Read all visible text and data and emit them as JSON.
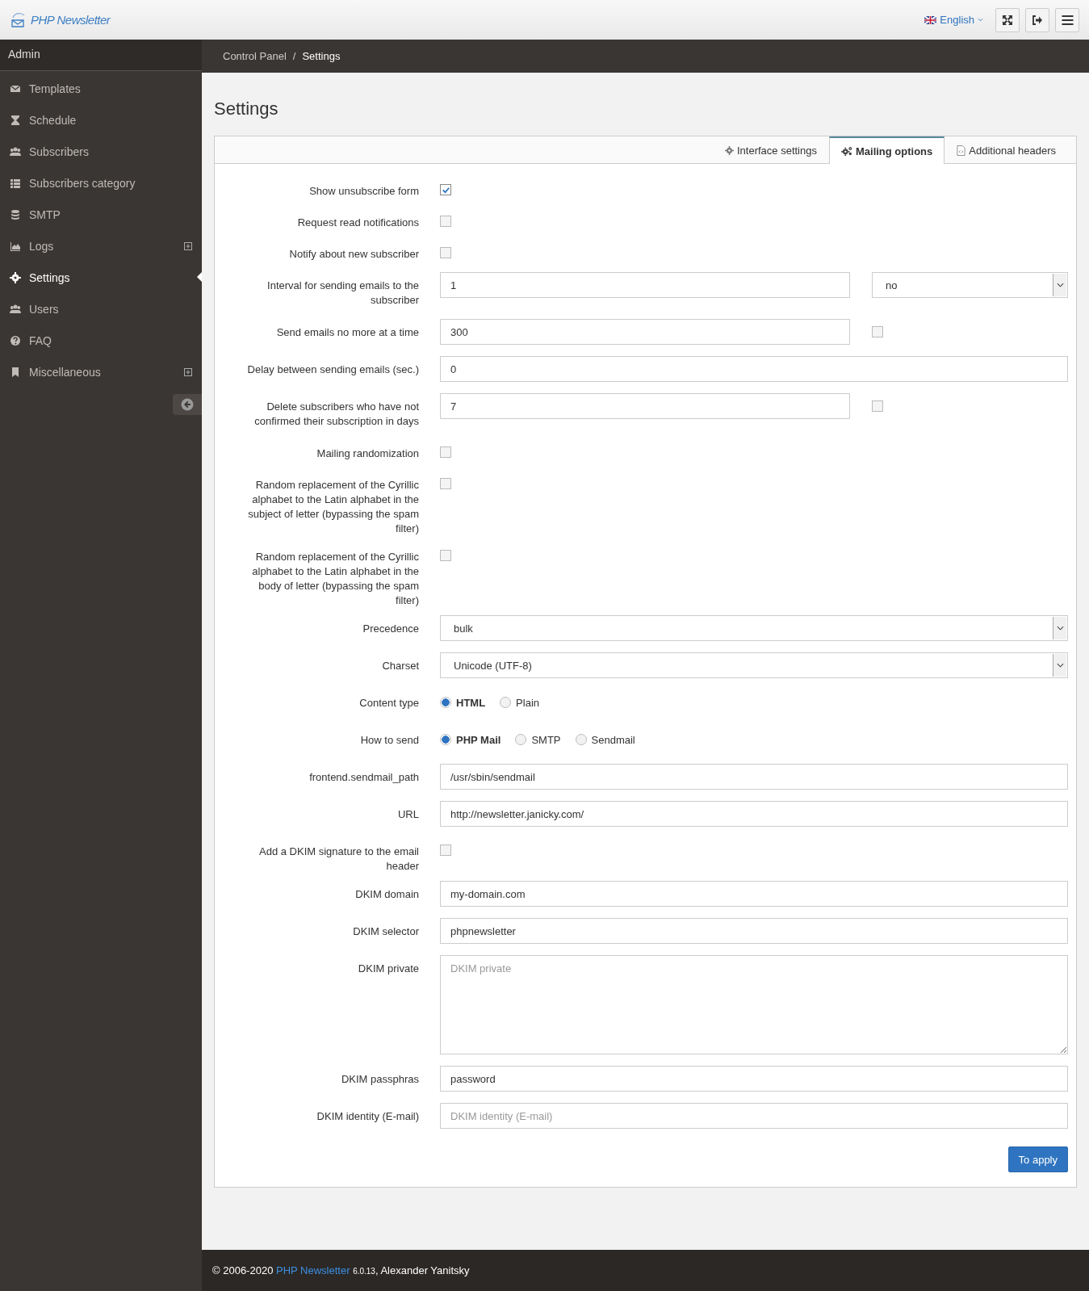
{
  "header": {
    "logo": "PHP Newsletter",
    "language": "English"
  },
  "sidebar": {
    "title": "Admin",
    "items": [
      {
        "label": "Templates",
        "selected": false,
        "expandable": false
      },
      {
        "label": "Schedule",
        "selected": false,
        "expandable": false
      },
      {
        "label": "Subscribers",
        "selected": false,
        "expandable": false
      },
      {
        "label": "Subscribers category",
        "selected": false,
        "expandable": false
      },
      {
        "label": "SMTP",
        "selected": false,
        "expandable": false
      },
      {
        "label": "Logs",
        "selected": false,
        "expandable": true
      },
      {
        "label": "Settings",
        "selected": true,
        "expandable": false
      },
      {
        "label": "Users",
        "selected": false,
        "expandable": false
      },
      {
        "label": "FAQ",
        "selected": false,
        "expandable": false
      },
      {
        "label": "Miscellaneous",
        "selected": false,
        "expandable": true
      }
    ]
  },
  "breadcrumb": {
    "items": [
      "Control Panel",
      "Settings"
    ],
    "separator": "/"
  },
  "page_title": "Settings",
  "tabs": [
    {
      "label": "Interface settings",
      "selected": false
    },
    {
      "label": "Mailing options",
      "selected": true
    },
    {
      "label": "Additional headers",
      "selected": false
    }
  ],
  "form": [
    {
      "kind": "checkbox",
      "label": "Show unsubscribe form",
      "checked": true
    },
    {
      "kind": "checkbox",
      "label": "Request read notifications",
      "checked": false
    },
    {
      "kind": "checkbox",
      "label": "Notify about new subscriber",
      "checked": false
    },
    {
      "kind": "input",
      "label": "Interval for sending emails to the subscriber",
      "value": "1",
      "extra": {
        "kind": "select",
        "value": "no"
      }
    },
    {
      "kind": "input",
      "label": "Send emails no more at a time",
      "value": "300",
      "extra": {
        "kind": "checkbox",
        "checked": false
      }
    },
    {
      "kind": "input",
      "label": "Delay between sending emails (sec.)",
      "value": "0"
    },
    {
      "kind": "input",
      "label": "Delete subscribers who have not confirmed their subscription in days",
      "value": "7",
      "extra": {
        "kind": "checkbox",
        "checked": false
      }
    },
    {
      "kind": "checkbox",
      "label": "Mailing randomization",
      "checked": false
    },
    {
      "kind": "checkbox",
      "label": "Random replacement of the Cyrillic alphabet to the Latin alphabet in the subject of letter (bypassing the spam filter)",
      "checked": false
    },
    {
      "kind": "checkbox",
      "label": "Random replacement of the Cyrillic alphabet to the Latin alphabet in the body of letter (bypassing the spam filter)",
      "checked": false
    },
    {
      "kind": "select",
      "label": "Precedence",
      "value": "bulk"
    },
    {
      "kind": "select",
      "label": "Charset",
      "value": "Unicode (UTF-8)"
    },
    {
      "kind": "radio",
      "label": "Content type",
      "options": [
        {
          "label": "HTML",
          "selected": true
        },
        {
          "label": "Plain",
          "selected": false
        }
      ]
    },
    {
      "kind": "radio",
      "label": "How to send",
      "options": [
        {
          "label": "PHP Mail",
          "selected": true
        },
        {
          "label": "SMTP",
          "selected": false
        },
        {
          "label": "Sendmail",
          "selected": false
        }
      ]
    },
    {
      "kind": "input",
      "label": "frontend.sendmail_path",
      "value": "/usr/sbin/sendmail"
    },
    {
      "kind": "input",
      "label": "URL",
      "value": "http://newsletter.janicky.com/"
    },
    {
      "kind": "checkbox",
      "label": "Add a DKIM signature to the email header",
      "checked": false
    },
    {
      "kind": "input",
      "label": "DKIM domain",
      "value": "my-domain.com"
    },
    {
      "kind": "input",
      "label": "DKIM selector",
      "value": "phpnewsletter"
    },
    {
      "kind": "textarea",
      "label": "DKIM private",
      "placeholder": "DKIM private"
    },
    {
      "kind": "input",
      "label": "DKIM passphras",
      "value": "password"
    },
    {
      "kind": "input",
      "label": "DKIM identity (E-mail)",
      "placeholder": "DKIM identity (E-mail)"
    }
  ],
  "apply_button": "To apply",
  "footer": {
    "prefix": "© 2006-2020",
    "link": "PHP Newsletter",
    "version": "6.0.13",
    "suffix": ", Alexander Yanitsky"
  }
}
